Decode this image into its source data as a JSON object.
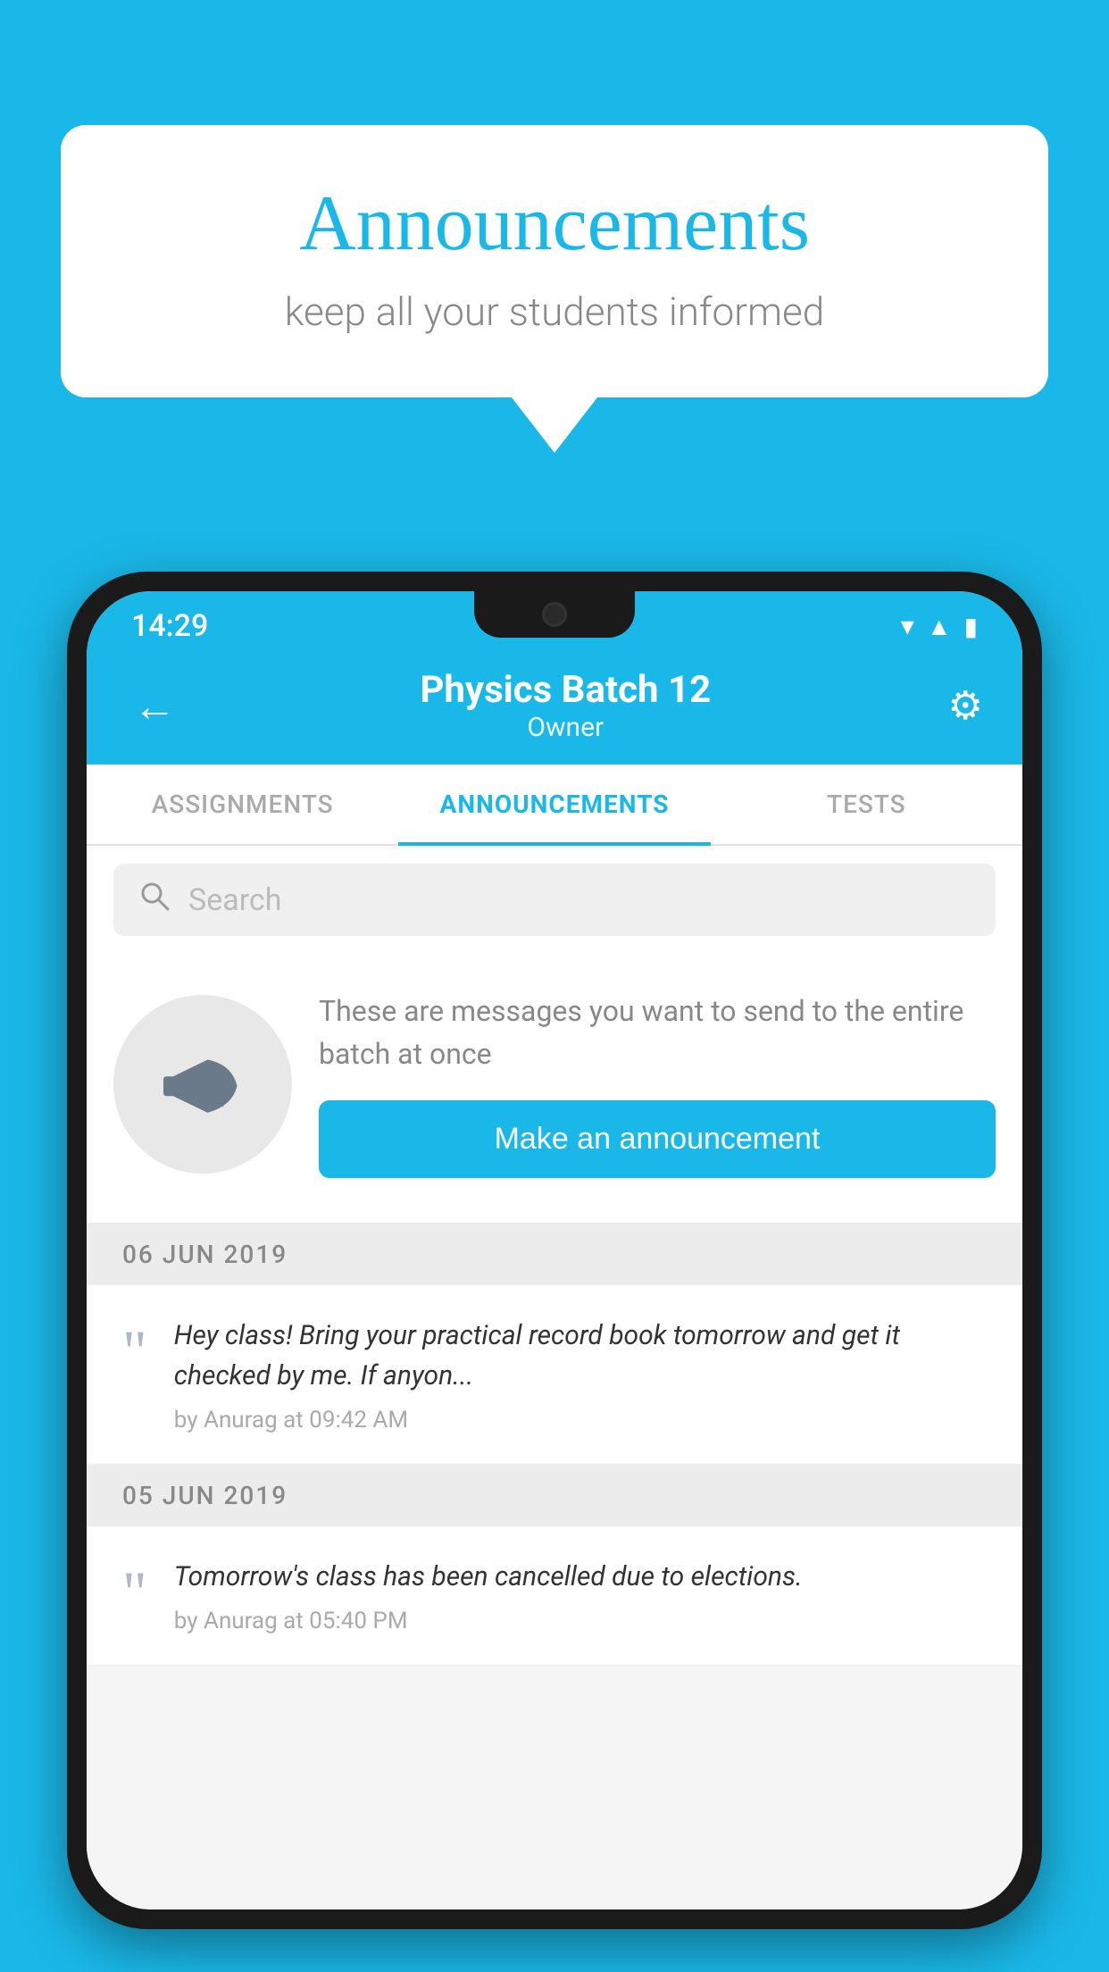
{
  "background": {
    "color": "#1ab8e8"
  },
  "speech_bubble": {
    "title": "Announcements",
    "subtitle": "keep all your students informed"
  },
  "phone": {
    "status_bar": {
      "time": "14:29"
    },
    "header": {
      "title": "Physics Batch 12",
      "subtitle": "Owner",
      "back_label": "←",
      "settings_label": "⚙"
    },
    "tabs": [
      {
        "label": "ASSIGNMENTS",
        "active": false
      },
      {
        "label": "ANNOUNCEMENTS",
        "active": true
      },
      {
        "label": "TESTS",
        "active": false
      }
    ],
    "search": {
      "placeholder": "Search"
    },
    "announcement_prompt": {
      "description": "These are messages you want to send to the entire batch at once",
      "button_label": "Make an announcement"
    },
    "announcements": [
      {
        "date": "06  JUN  2019",
        "message": "Hey class! Bring your practical record book tomorrow and get it checked by me. If anyon...",
        "author": "by Anurag at 09:42 AM"
      },
      {
        "date": "05  JUN  2019",
        "message": "Tomorrow's class has been cancelled due to elections.",
        "author": "by Anurag at 05:40 PM"
      }
    ]
  }
}
